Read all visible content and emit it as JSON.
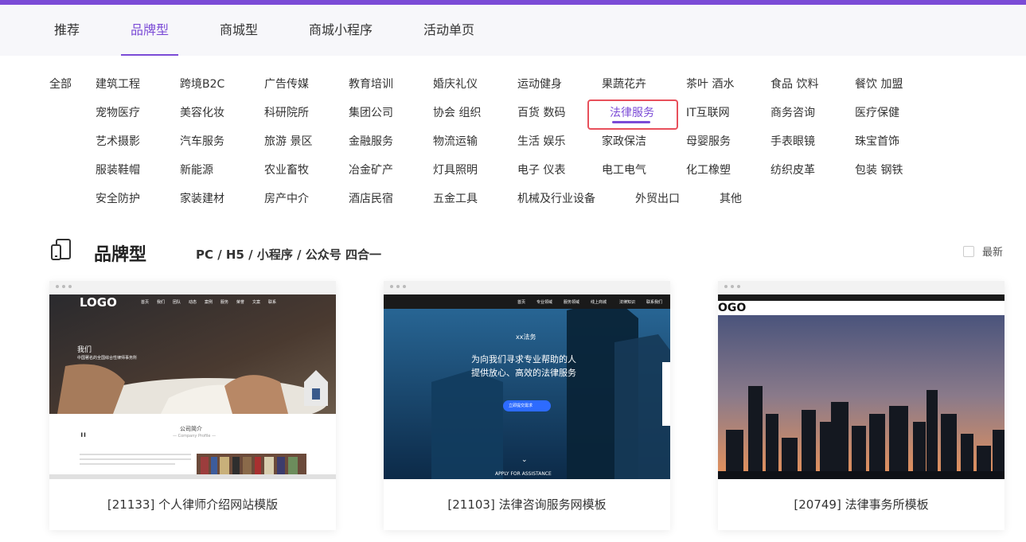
{
  "tabs": [
    {
      "label": "推荐"
    },
    {
      "label": "品牌型"
    },
    {
      "label": "商城型"
    },
    {
      "label": "商城小程序"
    },
    {
      "label": "活动单页"
    }
  ],
  "active_tab": "品牌型",
  "categories": {
    "all": "全部",
    "row1": [
      "建筑工程",
      "跨境B2C",
      "广告传媒",
      "教育培训",
      "婚庆礼仪",
      "运动健身",
      "果蔬花卉",
      "茶叶 酒水",
      "食品 饮料",
      "餐饮 加盟"
    ],
    "row2": [
      "宠物医疗",
      "美容化妆",
      "科研院所",
      "集团公司",
      "协会 组织",
      "百货 数码",
      "法律服务",
      "IT互联网",
      "商务咨询",
      "医疗保健"
    ],
    "row3": [
      "艺术摄影",
      "汽车服务",
      "旅游 景区",
      "金融服务",
      "物流运输",
      "生活 娱乐",
      "家政保洁",
      "母婴服务",
      "手表眼镜",
      "珠宝首饰"
    ],
    "row4": [
      "服装鞋帽",
      "新能源",
      "农业畜牧",
      "冶金矿产",
      "灯具照明",
      "电子 仪表",
      "电工电气",
      "化工橡塑",
      "纺织皮革",
      "包装 钢铁"
    ],
    "row5": [
      "安全防护",
      "家装建材",
      "房产中介",
      "酒店民宿",
      "五金工具",
      "机械及行业设备",
      "外贸出口",
      "其他"
    ],
    "selected": "法律服务"
  },
  "section": {
    "icon": "device-icon",
    "title": "品牌型",
    "subtitle": "PC / H5 / 小程序 / 公众号 四合一",
    "newest_label": "最新"
  },
  "cards": [
    {
      "caption": "[21133] 个人律师介绍网站模版",
      "logo": "LOGO",
      "nav": [
        "首页",
        "我们",
        "团队",
        "动态",
        "案例",
        "服务",
        "荣誉",
        "文案",
        "联系"
      ],
      "heading": "我们",
      "subheading": "中国著名的全国综合性律师事务所",
      "intro_title": "公司简介",
      "intro_sub": "— Company Profile —"
    },
    {
      "caption": "[21103] 法律咨询服务网模板",
      "nav": [
        "首页",
        "专业领域",
        "服务领域",
        "线上商城",
        "法律知识",
        "联系我们"
      ],
      "brand": "xx法务",
      "headline1": "为向我们寻求专业帮助的人",
      "headline2": "提供放心、高效的法律服务",
      "button": "立即提交需求",
      "footer": "APPLY FOR ASSISTANCE"
    },
    {
      "caption": "[20749] 法律事务所模板",
      "logo": "OGO"
    }
  ],
  "colors": {
    "accent": "#7b4bd6",
    "highlight": "#e8505b"
  }
}
